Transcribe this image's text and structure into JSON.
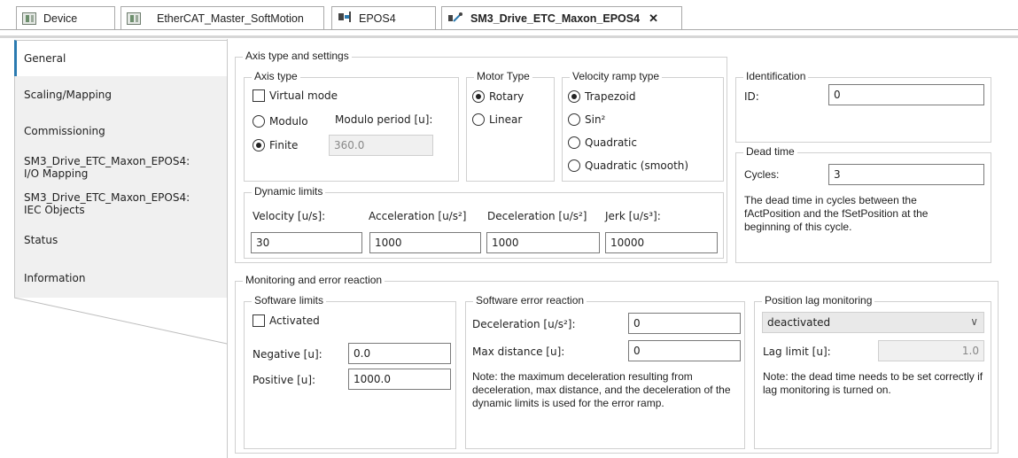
{
  "tabs": [
    {
      "label": "Device",
      "icon": "device-icon"
    },
    {
      "label": "EtherCAT_Master_SoftMotion",
      "icon": "device-icon"
    },
    {
      "label": "EPOS4",
      "icon": "drive-icon"
    },
    {
      "label": "SM3_Drive_ETC_Maxon_EPOS4",
      "icon": "axis-icon",
      "active": true
    }
  ],
  "nav": [
    {
      "label": "General"
    },
    {
      "label": "Scaling/Mapping"
    },
    {
      "label": "Commissioning"
    },
    {
      "label": "SM3_Drive_ETC_Maxon_EPOS4: I/O Mapping"
    },
    {
      "label": "SM3_Drive_ETC_Maxon_EPOS4: IEC Objects"
    },
    {
      "label": "Status"
    },
    {
      "label": "Information"
    }
  ],
  "axis": {
    "group_title": "Axis type and settings",
    "axis_type": {
      "title": "Axis type",
      "virtual_mode": "Virtual mode",
      "modulo": "Modulo",
      "modulo_period_label": "Modulo period [u]:",
      "finite": "Finite",
      "modulo_period_value": "360.0"
    },
    "motor_type": {
      "title": "Motor Type",
      "rotary": "Rotary",
      "linear": "Linear"
    },
    "velocity_ramp": {
      "title": "Velocity ramp type",
      "trapezoid": "Trapezoid",
      "sin2": "Sin²",
      "quadratic": "Quadratic",
      "quadratic_smooth": "Quadratic (smooth)"
    },
    "dynamic_limits": {
      "title": "Dynamic limits",
      "velocity_label": "Velocity [u/s]:",
      "acceleration_label": "Acceleration [u/s²]",
      "deceleration_label": "Deceleration [u/s²]",
      "jerk_label": "Jerk [u/s³]:",
      "velocity": "30",
      "acceleration": "1000",
      "deceleration": "1000",
      "jerk": "10000"
    }
  },
  "identification": {
    "title": "Identification",
    "id_label": "ID:",
    "id_value": "0"
  },
  "dead_time": {
    "title": "Dead time",
    "cycles_label": "Cycles:",
    "cycles_value": "3",
    "note": "The dead time in cycles between the fActPosition and the fSetPosition at the beginning of this cycle."
  },
  "monitoring": {
    "group_title": "Monitoring and error reaction",
    "software_limits": {
      "title": "Software limits",
      "activated": "Activated",
      "negative_label": "Negative [u]:",
      "negative_value": "0.0",
      "positive_label": "Positive [u]:",
      "positive_value": "1000.0"
    },
    "error_reaction": {
      "title": "Software error reaction",
      "decel_label": "Deceleration [u/s²]:",
      "decel_value": "0",
      "max_dist_label": "Max distance [u]:",
      "max_dist_value": "0",
      "note": "Note: the maximum deceleration resulting from deceleration, max distance, and the deceleration of the dynamic limits is used for the error ramp."
    },
    "lag": {
      "title": "Position lag monitoring",
      "mode_value": "deactivated",
      "lag_limit_label": "Lag limit [u]:",
      "lag_limit_value": "1.0",
      "note": "Note: the dead time needs to be set correctly if lag monitoring is turned on."
    }
  },
  "colors": {
    "nav_accent": "#2a7ab0"
  }
}
